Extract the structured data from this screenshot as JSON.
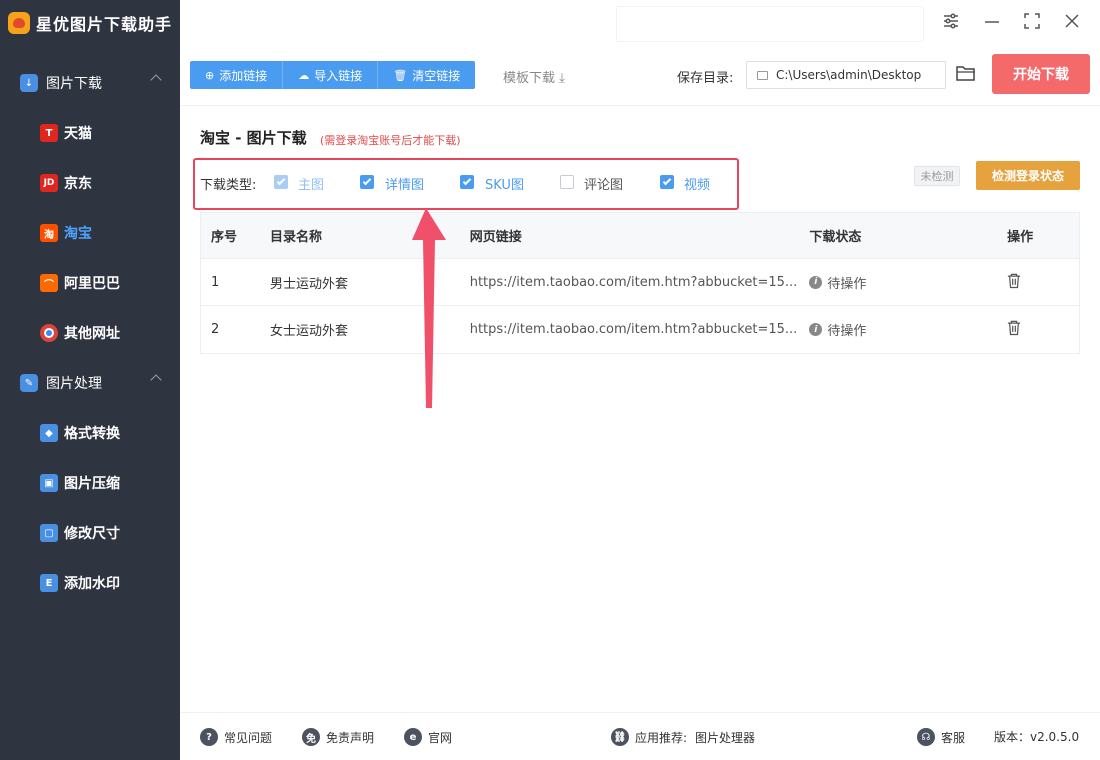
{
  "app": {
    "title": "星优图片下载助手"
  },
  "sidebar": {
    "sections": [
      {
        "label": "图片下载",
        "items": [
          {
            "label": "天猫",
            "icon": "tmall-icon",
            "icon_text": "T",
            "color": "#e0271f"
          },
          {
            "label": "京东",
            "icon": "jd-icon",
            "icon_text": "JD",
            "color": "#e0271f"
          },
          {
            "label": "淘宝",
            "icon": "taobao-icon",
            "icon_text": "淘",
            "color": "#ff5000",
            "active": true
          },
          {
            "label": "阿里巴巴",
            "icon": "alibaba-icon",
            "icon_text": "⌒",
            "color": "#ff6a00"
          },
          {
            "label": "其他网址",
            "icon": "chrome-icon",
            "icon_text": "●",
            "color": "#4285f4"
          }
        ]
      },
      {
        "label": "图片处理",
        "items": [
          {
            "label": "格式转换",
            "icon": "format-convert-icon",
            "icon_text": "◆",
            "color": "#4a90e2"
          },
          {
            "label": "图片压缩",
            "icon": "image-compress-icon",
            "icon_text": "▣",
            "color": "#4a90e2"
          },
          {
            "label": "修改尺寸",
            "icon": "resize-icon",
            "icon_text": "▢",
            "color": "#4a90e2"
          },
          {
            "label": "添加水印",
            "icon": "watermark-icon",
            "icon_text": "E",
            "color": "#4a90e2"
          }
        ]
      }
    ]
  },
  "toolbar": {
    "add_link": "添加链接",
    "import_link": "导入链接",
    "clear_link": "清空链接",
    "template_download": "模板下载",
    "save_dir_label": "保存目录:",
    "save_dir_value": "C:\\Users\\admin\\Desktop",
    "start_download": "开始下载"
  },
  "main": {
    "title": "淘宝 - 图片下载",
    "note": "(需登录淘宝账号后才能下载)",
    "download_type_label": "下载类型:",
    "types": [
      {
        "label": "主图",
        "state": "checked-disabled"
      },
      {
        "label": "详情图",
        "state": "checked"
      },
      {
        "label": "SKU图",
        "state": "checked"
      },
      {
        "label": "评论图",
        "state": "unchecked"
      },
      {
        "label": "视频",
        "state": "checked"
      }
    ],
    "login_status_badge": "未检测",
    "check_login_button": "检测登录状态"
  },
  "table": {
    "headers": [
      "序号",
      "目录名称",
      "网页链接",
      "下载状态",
      "操作"
    ],
    "rows": [
      {
        "index": "1",
        "name": "男士运动外套",
        "url": "https://item.taobao.com/item.htm?abbucket=15...",
        "status": "待操作"
      },
      {
        "index": "2",
        "name": "女士运动外套",
        "url": "https://item.taobao.com/item.htm?abbucket=15...",
        "status": "待操作"
      }
    ]
  },
  "footer": {
    "faq": "常见问题",
    "disclaimer": "免责声明",
    "website": "官网",
    "recommend_label": "应用推荐:",
    "recommend_app": "图片处理器",
    "support": "客服",
    "version": "版本：v2.0.5.0"
  },
  "colors": {
    "sidebar_bg": "#2f3441",
    "primary": "#4a9cf0",
    "danger": "#f46a6a",
    "warning": "#e6a23c",
    "highlight_box": "#e8445b"
  }
}
